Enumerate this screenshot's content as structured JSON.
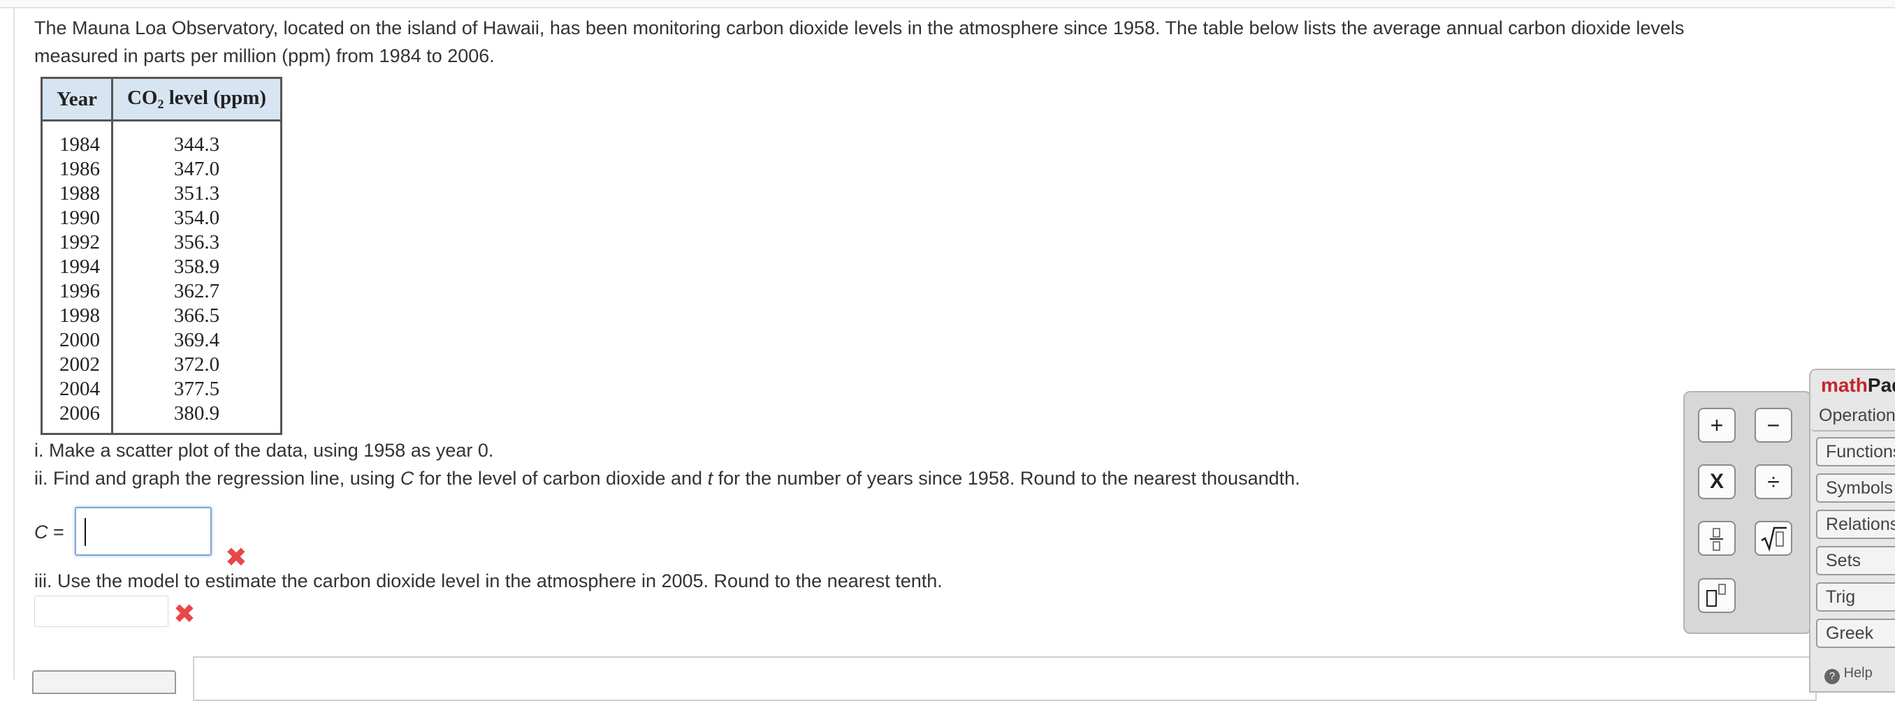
{
  "intro": {
    "line1": "The Mauna Loa Observatory, located on the island of Hawaii, has been monitoring carbon dioxide levels in the atmosphere since 1958. The table below lists the average annual carbon dioxide levels",
    "line2": "measured in parts per million (ppm) from 1984 to 2006."
  },
  "table": {
    "col_year": "Year",
    "col_co2_pre": "CO",
    "col_co2_sub": "2",
    "col_co2_post": " level (ppm)",
    "rows": [
      {
        "year": "1984",
        "value": "344.3"
      },
      {
        "year": "1986",
        "value": "347.0"
      },
      {
        "year": "1988",
        "value": "351.3"
      },
      {
        "year": "1990",
        "value": "354.0"
      },
      {
        "year": "1992",
        "value": "356.3"
      },
      {
        "year": "1994",
        "value": "358.9"
      },
      {
        "year": "1996",
        "value": "362.7"
      },
      {
        "year": "1998",
        "value": "366.5"
      },
      {
        "year": "2000",
        "value": "369.4"
      },
      {
        "year": "2002",
        "value": "372.0"
      },
      {
        "year": "2004",
        "value": "377.5"
      },
      {
        "year": "2006",
        "value": "380.9"
      }
    ]
  },
  "q1": "i. Make a scatter plot of the data, using 1958 as year 0.",
  "q2": {
    "a": "ii. Find and graph the regression line, using ",
    "var_c": "C",
    "b": " for the level of carbon dioxide and ",
    "var_t": "t",
    "c": " for the number of years since 1958. Round to the nearest thousandth."
  },
  "equation": {
    "var": "C",
    "equals": " =",
    "value": ""
  },
  "q3": "iii. Use the model to estimate the carbon dioxide level in the atmosphere in 2005. Round to the nearest tenth.",
  "answer_value": "",
  "wrong_mark": "✖",
  "keypad": {
    "plus": "+",
    "minus": "−",
    "times": "X",
    "divide": "÷",
    "fraction_icon": "fraction-icon",
    "sqrt_icon": "square-root-icon",
    "exponent_icon": "exponent-icon"
  },
  "mathpad": {
    "title_a": "math",
    "title_b": "Pad",
    "tabs": [
      "Operations",
      "Functions",
      "Symbols",
      "Relations",
      "Sets",
      "Trig",
      "Greek"
    ],
    "help": "Help"
  }
}
